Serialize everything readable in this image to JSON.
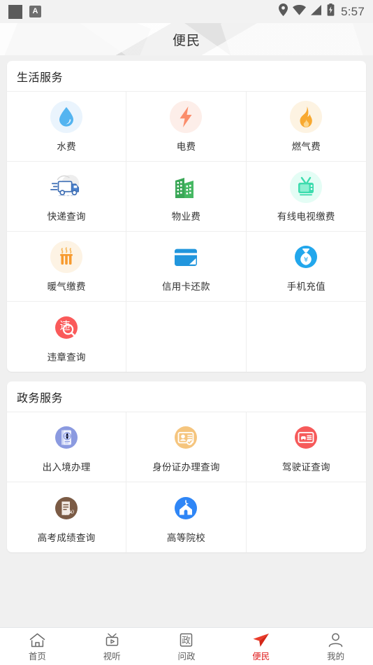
{
  "statusbar": {
    "app_badge": "A",
    "time": "5:57",
    "icons": [
      "location-pin-icon",
      "wifi-icon",
      "signal-icon",
      "battery-charging-icon"
    ]
  },
  "header": {
    "title": "便民"
  },
  "colors": {
    "page_bg": "#f0f0f0",
    "card_bg": "#ffffff",
    "accent_active": "#e02020",
    "water_blue": "#54b4f0",
    "power_orange": "#fb8d6b",
    "gas_orange": "#f8a930",
    "express_blue": "#3f6fb5",
    "property_green": "#3aa757",
    "tv_mint": "#3ddcae",
    "heat_orange": "#f79a2e",
    "card_blue": "#2196dd",
    "recharge_blue": "#22a7ec",
    "violation_red": "#fa5a5a",
    "passport_purple": "#8b9ae0",
    "idcard_tan": "#f5c57e",
    "license_red": "#f65a5a",
    "gaokao_brown": "#7b5b45",
    "college_blue": "#2f86f6"
  },
  "sections": [
    {
      "title": "生活服务",
      "items": [
        {
          "label": "水费",
          "icon": "water-drop-icon"
        },
        {
          "label": "电费",
          "icon": "lightning-bolt-icon"
        },
        {
          "label": "燃气费",
          "icon": "flame-icon"
        },
        {
          "label": "快递查询",
          "icon": "delivery-truck-icon"
        },
        {
          "label": "物业费",
          "icon": "buildings-icon"
        },
        {
          "label": "有线电视缴费",
          "icon": "television-icon"
        },
        {
          "label": "暖气缴费",
          "icon": "radiator-icon"
        },
        {
          "label": "信用卡还款",
          "icon": "credit-card-icon"
        },
        {
          "label": "手机充值",
          "icon": "money-bag-icon"
        },
        {
          "label": "违章查询",
          "icon": "traffic-violation-icon"
        },
        {
          "label": "",
          "icon": ""
        },
        {
          "label": "",
          "icon": ""
        }
      ]
    },
    {
      "title": "政务服务",
      "items": [
        {
          "label": "出入境办理",
          "icon": "passport-icon"
        },
        {
          "label": "身份证办理查询",
          "icon": "id-card-icon"
        },
        {
          "label": "驾驶证查询",
          "icon": "drivers-license-icon"
        },
        {
          "label": "高考成绩查询",
          "icon": "exam-paper-icon"
        },
        {
          "label": "高等院校",
          "icon": "university-icon"
        },
        {
          "label": "",
          "icon": ""
        }
      ]
    }
  ],
  "tabbar": {
    "tabs": [
      {
        "label": "首页",
        "icon": "home-icon",
        "active": false
      },
      {
        "label": "视听",
        "icon": "tv-play-icon",
        "active": false
      },
      {
        "label": "问政",
        "icon": "government-box-icon",
        "active": false
      },
      {
        "label": "便民",
        "icon": "paper-plane-icon",
        "active": true
      },
      {
        "label": "我的",
        "icon": "person-icon",
        "active": false
      }
    ]
  }
}
